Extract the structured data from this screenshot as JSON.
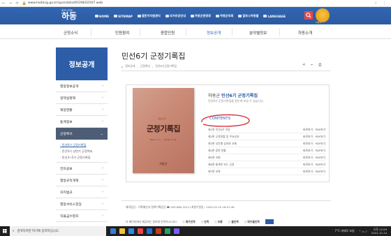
{
  "browser": {
    "url": "www.hadong.go.kr/opendata/00198/02507.web"
  },
  "header": {
    "logo": "하동",
    "logo_sub": "알프스하동",
    "menu": [
      "HOME",
      "SITEMAP",
      "열린이자원관리",
      "국가유공안내",
      "하동군관광로",
      "하동군의회",
      "알프스하동몰",
      "LANGUAGE"
    ],
    "mascot": "하동이"
  },
  "nav": {
    "items": [
      "군정소식",
      "민원참여",
      "종합민원",
      "정보공개",
      "분야별정보",
      "하동소개"
    ],
    "active_index": 3
  },
  "sidebar": {
    "title": "정보공개",
    "items_before": [
      "행정정보공개",
      "정책실명제",
      "재정현황",
      "통계정보"
    ],
    "active": "군정백서",
    "sub_items": [
      "민선6기 군정기록집",
      "민선5기 상반기 군정백서",
      "민선3~5기 군정기록집"
    ],
    "items_after": [
      "전자공보",
      "행정규칙개혁",
      "자치법규",
      "행정서비스헌장",
      "직불금수령자"
    ]
  },
  "page": {
    "title": "민선6기 군정기록집",
    "breadcrumb": [
      "정보공개",
      "군정백서",
      "민선6기군정기록집"
    ]
  },
  "book": {
    "title": "군정기록집",
    "small_title": "민선 6기",
    "date": "2014. 7. 1. ~ 2018. 6. 30.",
    "publisher": "하동군"
  },
  "document": {
    "org": "하동군",
    "name": "민선6기 군정기록집",
    "desc": "민선6기 군정기록집을 한눈에 보실 수 있습니다.",
    "contents_label": "CONTENTS",
    "toc": [
      {
        "text": "제1편 민선6기 하동",
        "links": "바로보기 · PDF보기"
      },
      {
        "text": "제2편 군정현황 및 주요성과",
        "links": "바로보기 · PDF보기"
      },
      {
        "text": "제3편 부문별 성과와 과제",
        "links": "바로보기 · PDF보기"
      },
      {
        "text": "제4편 읍면 현황",
        "links": "바로보기 · PDF보기"
      },
      {
        "text": "제5편 의회",
        "links": "바로보기 · PDF보기"
      },
      {
        "text": "제6편 통계로 보는 군정",
        "links": "바로보기 · PDF보기"
      },
      {
        "text": "제7편 부록",
        "links": "바로보기 · PDF보기"
      }
    ]
  },
  "meta": "제어담당 : 기획예산과 정책기획담당 ☎ 055-880-2011) 최종수정일 : 2020-02-19 18:07:46",
  "survey": {
    "question": "이 페이지에서 제공하는 정보에 만족하시나요?",
    "options": [
      "매우만족",
      "만족",
      "보통",
      "불만족",
      "매우불만족"
    ]
  },
  "taskbar": {
    "search_placeholder": "검색하려면 여기에 입력하십시오.",
    "weather": "7°C 대체로 흐림",
    "time": "오후 12:59",
    "date": "2021-12-14"
  },
  "colors": {
    "brand_blue": "#2d5da7",
    "accent_red": "#e5484d",
    "sidebar_active": "#4d5d75"
  }
}
